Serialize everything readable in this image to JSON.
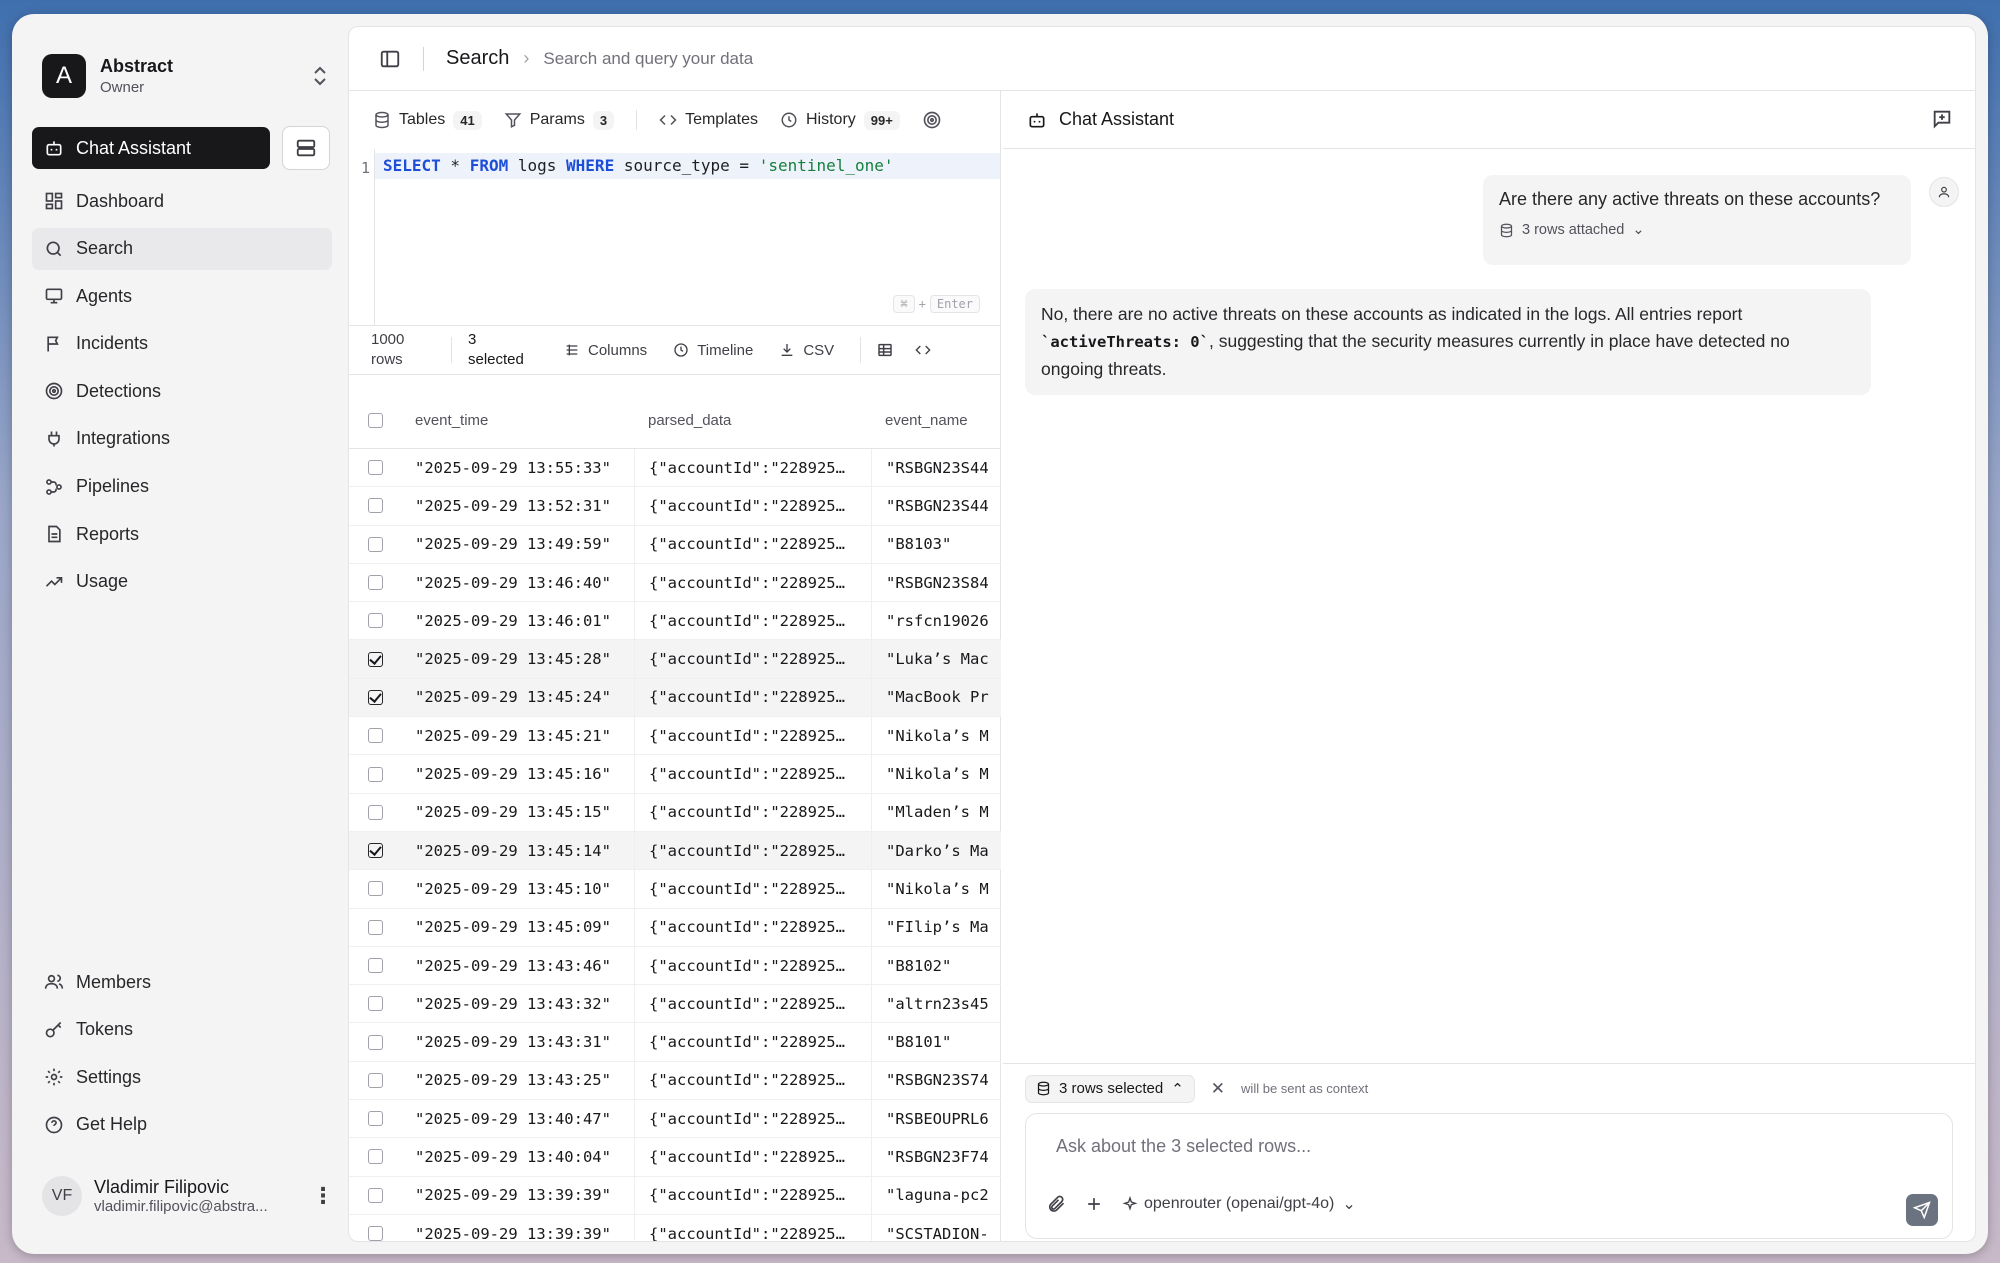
{
  "org": {
    "initial": "A",
    "name": "Abstract",
    "role": "Owner"
  },
  "sidebar": {
    "chat_button": "Chat Assistant",
    "items": [
      {
        "label": "Dashboard",
        "icon": "dashboard-icon"
      },
      {
        "label": "Search",
        "icon": "search-icon",
        "active": true
      },
      {
        "label": "Agents",
        "icon": "monitor-icon"
      },
      {
        "label": "Incidents",
        "icon": "flag-icon"
      },
      {
        "label": "Detections",
        "icon": "radar-icon"
      },
      {
        "label": "Integrations",
        "icon": "plug-icon"
      },
      {
        "label": "Pipelines",
        "icon": "workflow-icon"
      },
      {
        "label": "Reports",
        "icon": "file-icon"
      },
      {
        "label": "Usage",
        "icon": "trend-icon"
      }
    ],
    "bottom_items": [
      {
        "label": "Members",
        "icon": "users-icon"
      },
      {
        "label": "Tokens",
        "icon": "key-icon"
      },
      {
        "label": "Settings",
        "icon": "gear-icon"
      },
      {
        "label": "Get Help",
        "icon": "help-icon"
      }
    ]
  },
  "user": {
    "initials": "VF",
    "name": "Vladimir Filipovic",
    "email": "vladimir.filipovic@abstra..."
  },
  "header": {
    "title": "Search",
    "subtitle": "Search and query your data"
  },
  "query": {
    "tabs": [
      {
        "label": "Tables",
        "badge": "41"
      },
      {
        "label": "Params",
        "badge": "3"
      },
      {
        "label": "Templates"
      },
      {
        "label": "History",
        "badge": "99+"
      }
    ],
    "line_number": "1",
    "sql": {
      "kw1": "SELECT",
      "t1": " * ",
      "kw2": "FROM",
      "t2": " logs ",
      "kw3": "WHERE",
      "t3": " source_type = ",
      "str": "'sentinel_one'"
    },
    "hint_key": "⌘",
    "hint_plus": "+",
    "hint_enter": "Enter"
  },
  "results": {
    "count_num": "1000",
    "count_label": "rows",
    "selected_num": "3",
    "selected_label": "selected",
    "columns_label": "Columns",
    "timeline_label": "Timeline",
    "csv_label": "CSV",
    "headers": [
      "event_time",
      "parsed_data",
      "event_name"
    ],
    "rows": [
      {
        "time": "\"2025-09-29 13:55:33\"",
        "parsed": "{\"accountId\":\"228925…",
        "name": "\"RSBGN23S44",
        "selected": false
      },
      {
        "time": "\"2025-09-29 13:52:31\"",
        "parsed": "{\"accountId\":\"228925…",
        "name": "\"RSBGN23S44",
        "selected": false
      },
      {
        "time": "\"2025-09-29 13:49:59\"",
        "parsed": "{\"accountId\":\"228925…",
        "name": "\"B8103\"",
        "selected": false
      },
      {
        "time": "\"2025-09-29 13:46:40\"",
        "parsed": "{\"accountId\":\"228925…",
        "name": "\"RSBGN23S84",
        "selected": false
      },
      {
        "time": "\"2025-09-29 13:46:01\"",
        "parsed": "{\"accountId\":\"228925…",
        "name": "\"rsfcn19026",
        "selected": false
      },
      {
        "time": "\"2025-09-29 13:45:28\"",
        "parsed": "{\"accountId\":\"228925…",
        "name": "\"Luka’s Mac",
        "selected": true
      },
      {
        "time": "\"2025-09-29 13:45:24\"",
        "parsed": "{\"accountId\":\"228925…",
        "name": "\"MacBook Pr",
        "selected": true
      },
      {
        "time": "\"2025-09-29 13:45:21\"",
        "parsed": "{\"accountId\":\"228925…",
        "name": "\"Nikola’s M",
        "selected": false
      },
      {
        "time": "\"2025-09-29 13:45:16\"",
        "parsed": "{\"accountId\":\"228925…",
        "name": "\"Nikola’s M",
        "selected": false
      },
      {
        "time": "\"2025-09-29 13:45:15\"",
        "parsed": "{\"accountId\":\"228925…",
        "name": "\"Mladen’s M",
        "selected": false
      },
      {
        "time": "\"2025-09-29 13:45:14\"",
        "parsed": "{\"accountId\":\"228925…",
        "name": "\"Darko’s Ma",
        "selected": true
      },
      {
        "time": "\"2025-09-29 13:45:10\"",
        "parsed": "{\"accountId\":\"228925…",
        "name": "\"Nikola’s M",
        "selected": false
      },
      {
        "time": "\"2025-09-29 13:45:09\"",
        "parsed": "{\"accountId\":\"228925…",
        "name": "\"FIlip’s Ma",
        "selected": false
      },
      {
        "time": "\"2025-09-29 13:43:46\"",
        "parsed": "{\"accountId\":\"228925…",
        "name": "\"B8102\"",
        "selected": false
      },
      {
        "time": "\"2025-09-29 13:43:32\"",
        "parsed": "{\"accountId\":\"228925…",
        "name": "\"altrn23s45",
        "selected": false
      },
      {
        "time": "\"2025-09-29 13:43:31\"",
        "parsed": "{\"accountId\":\"228925…",
        "name": "\"B8101\"",
        "selected": false
      },
      {
        "time": "\"2025-09-29 13:43:25\"",
        "parsed": "{\"accountId\":\"228925…",
        "name": "\"RSBGN23S74",
        "selected": false
      },
      {
        "time": "\"2025-09-29 13:40:47\"",
        "parsed": "{\"accountId\":\"228925…",
        "name": "\"RSBEOUPRL6",
        "selected": false
      },
      {
        "time": "\"2025-09-29 13:40:04\"",
        "parsed": "{\"accountId\":\"228925…",
        "name": "\"RSBGN23F74",
        "selected": false
      },
      {
        "time": "\"2025-09-29 13:39:39\"",
        "parsed": "{\"accountId\":\"228925…",
        "name": "\"laguna-pc2",
        "selected": false
      },
      {
        "time": "\"2025-09-29 13:39:39\"",
        "parsed": "{\"accountId\":\"228925…",
        "name": "\"SCSTADION-",
        "selected": false
      }
    ]
  },
  "chat": {
    "title": "Chat Assistant",
    "user_message": "Are there any active threats on these accounts?",
    "attachment": "3 rows attached",
    "assistant_pre": "No, there are no active threats on these accounts as indicated in the logs. All entries report ",
    "assistant_code": "`activeThreats: 0`",
    "assistant_post": ", suggesting that the security measures currently in place have detected no ongoing threats.",
    "context_pill": "3 rows selected",
    "context_note": "will be sent as context",
    "placeholder": "Ask about the 3 selected rows...",
    "model": "openrouter (openai/gpt-4o)"
  }
}
